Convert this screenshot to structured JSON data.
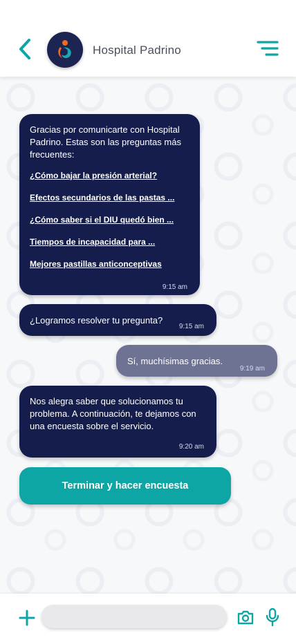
{
  "header": {
    "title": "Hospital Padrino",
    "back_icon": "chevron-left-icon",
    "menu_icon": "menu-icon",
    "accent_color": "#0ea5a5"
  },
  "messages": [
    {
      "sender": "hospital",
      "intro": "Gracias por comunicarte con Hospital Padrino. Estas son las preguntas más frecuentes:",
      "faq_links": [
        "¿Cómo bajar la presión arterial?",
        "Efectos secundarios de las pastas ...",
        "¿Cómo saber si el DIU quedó bien ...",
        "Tiempos de incapacidad para ...",
        "Mejores pastillas anticonceptivas"
      ],
      "time": "9:15 am"
    },
    {
      "sender": "hospital",
      "text": "¿Logramos resolver tu pregunta?",
      "time": "9:15 am"
    },
    {
      "sender": "user",
      "text": "Sí, muchísimas gracias.",
      "time": "9:19 am"
    },
    {
      "sender": "hospital",
      "text": "Nos alegra saber que solucionamos tu problema. A continuación, te dejamos con una encuesta sobre el servicio.",
      "time": "9:20 am"
    }
  ],
  "cta": {
    "label": "Terminar y hacer encuesta"
  },
  "composer": {
    "placeholder": "",
    "icons": [
      "plus-icon",
      "camera-icon",
      "microphone-icon"
    ]
  },
  "colors": {
    "incoming_bubble": "#141d4c",
    "outgoing_bubble": "#6e7394",
    "logo_orange": "#f36b21",
    "logo_teal": "#1aa7b0"
  }
}
